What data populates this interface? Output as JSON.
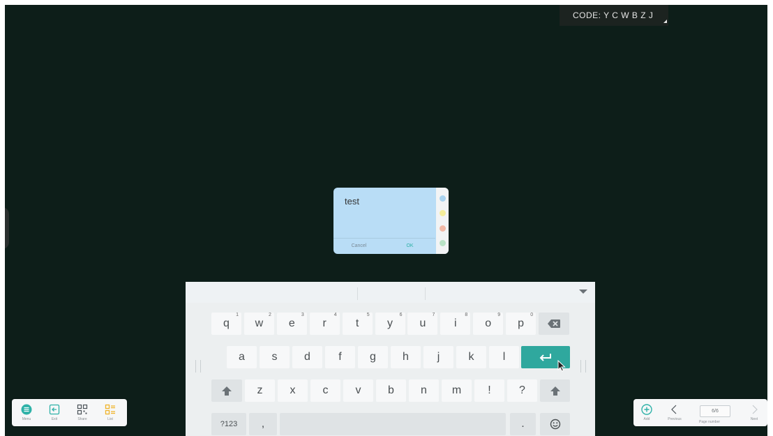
{
  "code_badge": {
    "text": "CODE: Y C W B Z J"
  },
  "note": {
    "text": "test",
    "cancel_label": "Cancel",
    "ok_label": "OK",
    "colors": [
      "#a9d3ef",
      "#f4ee9b",
      "#f2b9a6",
      "#b9e3c6"
    ]
  },
  "keyboard": {
    "row1": [
      {
        "label": "q",
        "hint": "1"
      },
      {
        "label": "w",
        "hint": "2"
      },
      {
        "label": "e",
        "hint": "3"
      },
      {
        "label": "r",
        "hint": "4"
      },
      {
        "label": "t",
        "hint": "5"
      },
      {
        "label": "y",
        "hint": "6"
      },
      {
        "label": "u",
        "hint": "7"
      },
      {
        "label": "i",
        "hint": "8"
      },
      {
        "label": "o",
        "hint": "9"
      },
      {
        "label": "p",
        "hint": "0"
      }
    ],
    "row2": [
      "a",
      "s",
      "d",
      "f",
      "g",
      "h",
      "j",
      "k",
      "l"
    ],
    "row3": [
      "z",
      "x",
      "c",
      "v",
      "b",
      "n",
      "m",
      "!",
      "?"
    ],
    "symbols_label": "?123",
    "comma_label": ",",
    "period_label": ".",
    "icons": {
      "backspace": "backspace-icon",
      "enter": "enter-icon",
      "shift": "shift-icon",
      "emoji": "emoji-icon",
      "collapse": "chevron-down-icon"
    },
    "accent_color": "#2fa89e"
  },
  "left_toolbar": {
    "items": [
      {
        "label": "Menu",
        "icon": "menu-icon"
      },
      {
        "label": "Exit",
        "icon": "exit-icon"
      },
      {
        "label": "Share",
        "icon": "qr-code-icon"
      },
      {
        "label": "List",
        "icon": "list-icon"
      }
    ]
  },
  "right_toolbar": {
    "add_label": "Add",
    "previous_label": "Previous",
    "page_value": "6/6",
    "page_number_label": "Page number",
    "next_label": "Next"
  }
}
